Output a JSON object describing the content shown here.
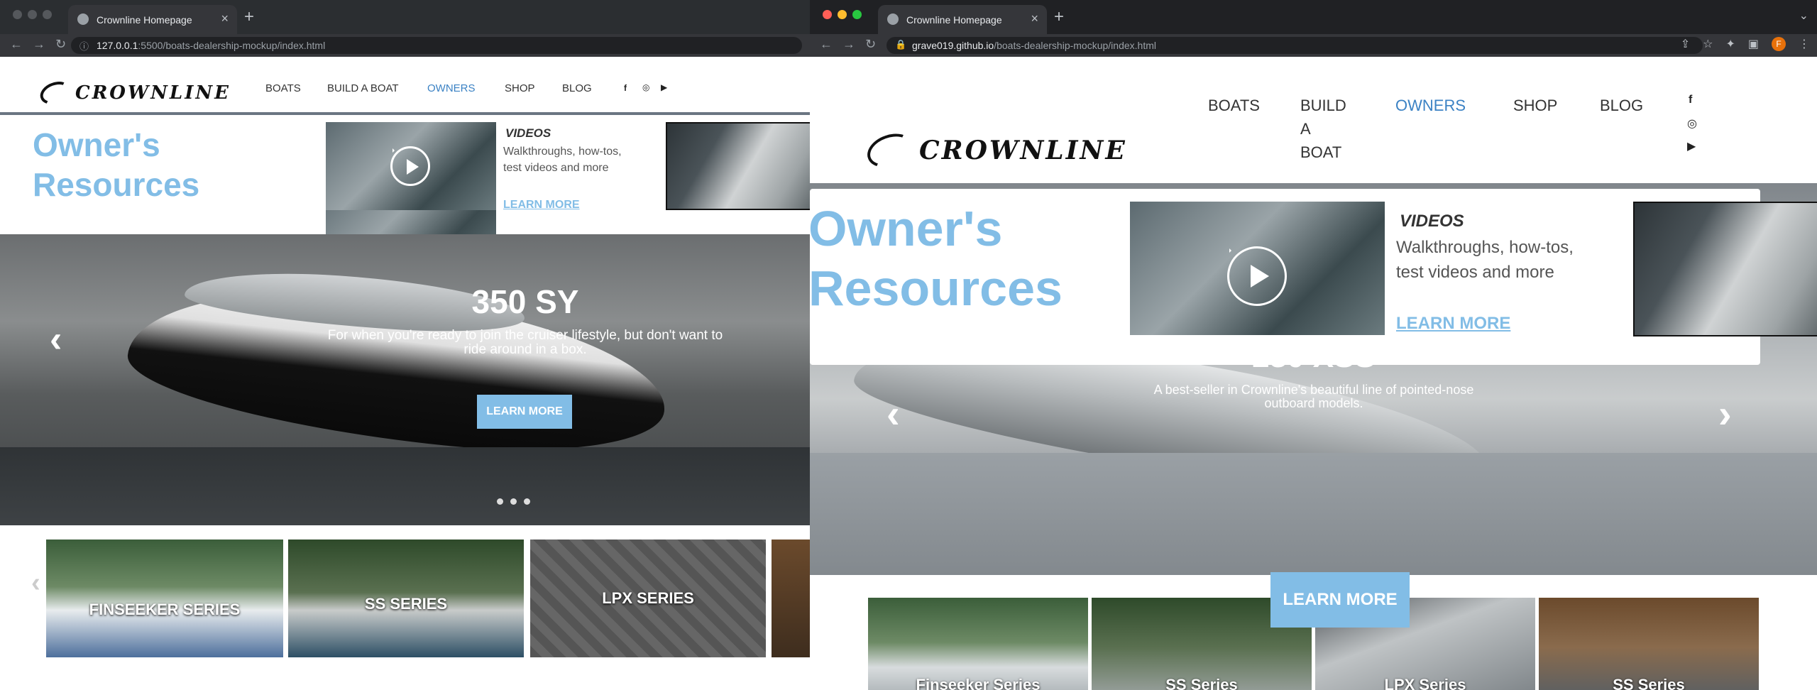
{
  "left": {
    "tab_title": "Crownline Homepage",
    "url_host": "127.0.0.1",
    "url_path": ":5500/boats-dealership-mockup/index.html",
    "logo_text": "CROWNLINE",
    "nav": [
      "BOATS",
      "BUILD A BOAT",
      "OWNERS",
      "SHOP",
      "BLOG"
    ],
    "promo": {
      "title_1": "Owner's",
      "title_2": "Resources",
      "videos_heading": "VIDEOS",
      "videos_text": "Walkthroughs, how-tos, test videos and more",
      "link": "LEARN MORE"
    },
    "hero": {
      "title": "350 SY",
      "subtitle": "For when you're ready to join the cruiser lifestyle, but don't want to ride around in a box.",
      "button": "LEARN MORE",
      "prev": "‹",
      "slide_count": 3
    },
    "series": [
      "FINSEEKER SERIES",
      "SS SERIES",
      "LPX SERIES"
    ],
    "prev": "‹"
  },
  "right": {
    "tab_title": "Crownline Homepage",
    "url_host": "grave019.github.io",
    "url_path": "/boats-dealership-mockup/index.html",
    "logo_text": "CROWNLINE",
    "nav": [
      "BOATS",
      "BUILD\nA\nBOAT",
      "OWNERS",
      "SHOP",
      "BLOG"
    ],
    "promo": {
      "title_1": "Owner's",
      "title_2": "Resources",
      "videos_heading": "VIDEOS",
      "videos_text": "Walkthroughs, how-tos, test videos and more",
      "link": "LEARN MORE"
    },
    "hero": {
      "title": "280 XSS",
      "subtitle": "A best-seller in Crownline's beautiful line of pointed-nose outboard models.",
      "prev": "‹",
      "next": "›"
    },
    "learn_more_button": "LEARN MORE",
    "series": [
      "Finseeker Series",
      "SS Series",
      "LPX Series",
      "SS Series"
    ],
    "avatar_initial": "F"
  },
  "colors": {
    "accent": "#82bde6",
    "active_nav": "#3b82c4",
    "dark_chrome": "#202124"
  },
  "icons": [
    "back-arrow-icon",
    "forward-arrow-icon",
    "reload-icon",
    "info-icon",
    "lock-icon",
    "share-icon",
    "star-icon",
    "extensions-icon",
    "sidebar-icon",
    "menu-icon",
    "facebook-icon",
    "instagram-icon",
    "youtube-icon",
    "play-icon"
  ]
}
